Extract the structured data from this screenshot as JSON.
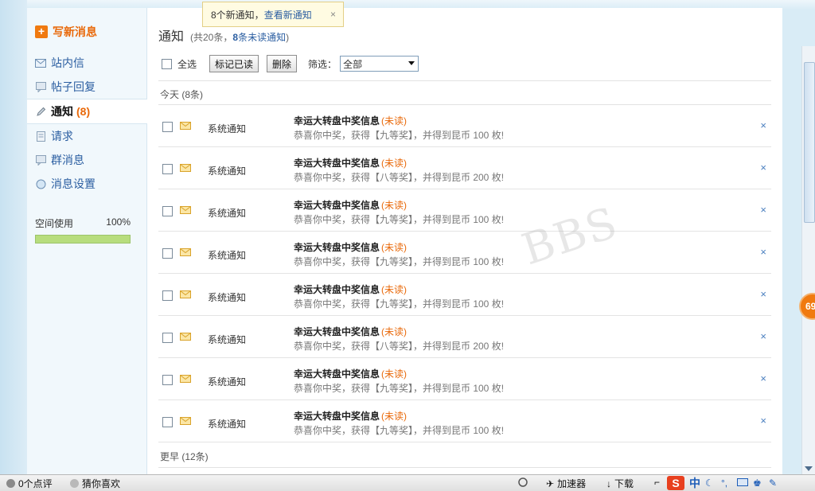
{
  "toast": {
    "text": "8个新通知，",
    "link": "查看新通知",
    "close": "×"
  },
  "sidebar": {
    "compose": "写新消息",
    "items": [
      {
        "label": "站内信",
        "icon": "envelope-icon"
      },
      {
        "label": "帖子回复",
        "icon": "speech-bubble-icon"
      },
      {
        "label": "通知",
        "icon": "pencil-icon",
        "count": "(8)",
        "active": true
      },
      {
        "label": "请求",
        "icon": "document-icon"
      },
      {
        "label": "群消息",
        "icon": "speech-bubble-icon"
      },
      {
        "label": "消息设置",
        "icon": "globe-icon"
      }
    ],
    "space": {
      "label": "空间使用",
      "percent": "100%",
      "fill": 1.0
    }
  },
  "main": {
    "title": "通知",
    "sub_open": "(共20条，",
    "sub_num": "8",
    "sub_unread": "条未读通知",
    "sub_close": ")",
    "toolbar": {
      "select_all": "全选",
      "mark_read": "标记已读",
      "delete": "删除",
      "filter_label": "筛选：",
      "filter_value": "全部"
    },
    "today_label": "今天 (8条)",
    "earlier_label": "更早 (12条)",
    "items": [
      {
        "type": "系统通知",
        "subject": "幸运大转盘中奖信息",
        "flag": "(未读)",
        "preview": "恭喜你中奖，获得【九等奖】，并得到昆币 100 枚!"
      },
      {
        "type": "系统通知",
        "subject": "幸运大转盘中奖信息",
        "flag": "(未读)",
        "preview": "恭喜你中奖，获得【八等奖】，并得到昆币 200 枚!"
      },
      {
        "type": "系统通知",
        "subject": "幸运大转盘中奖信息",
        "flag": "(未读)",
        "preview": "恭喜你中奖，获得【九等奖】，并得到昆币 100 枚!"
      },
      {
        "type": "系统通知",
        "subject": "幸运大转盘中奖信息",
        "flag": "(未读)",
        "preview": "恭喜你中奖，获得【九等奖】，并得到昆币 100 枚!"
      },
      {
        "type": "系统通知",
        "subject": "幸运大转盘中奖信息",
        "flag": "(未读)",
        "preview": "恭喜你中奖，获得【九等奖】，并得到昆币 100 枚!"
      },
      {
        "type": "系统通知",
        "subject": "幸运大转盘中奖信息",
        "flag": "(未读)",
        "preview": "恭喜你中奖，获得【八等奖】，并得到昆币 200 枚!"
      },
      {
        "type": "系统通知",
        "subject": "幸运大转盘中奖信息",
        "flag": "(未读)",
        "preview": "恭喜你中奖，获得【九等奖】，并得到昆币 100 枚!"
      },
      {
        "type": "系统通知",
        "subject": "幸运大转盘中奖信息",
        "flag": "(未读)",
        "preview": "恭喜你中奖，获得【九等奖】，并得到昆币 100 枚!"
      }
    ],
    "delete_glyph": "×",
    "watermark": "BBS"
  },
  "side_badge": "69",
  "statusbar": {
    "comments": "0个点评",
    "guess": "猜你喜欢",
    "accelerator": "加速器",
    "download": "下载",
    "ime_s": "S",
    "ime_zh": "中"
  }
}
